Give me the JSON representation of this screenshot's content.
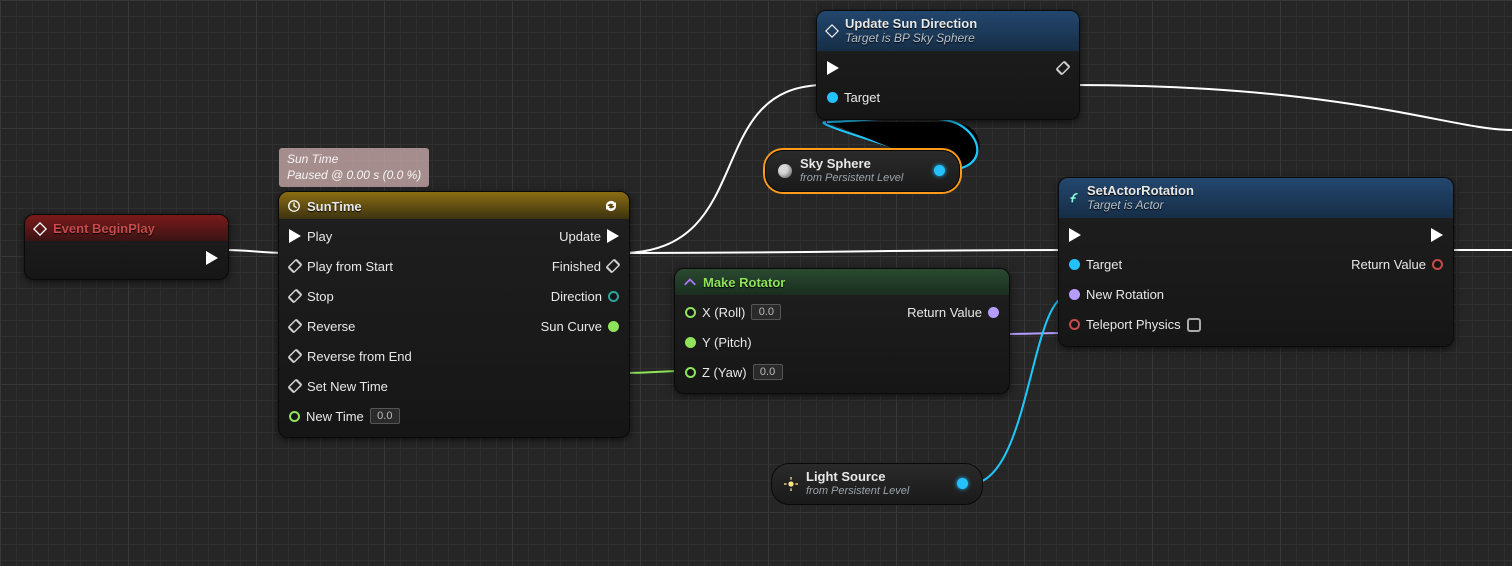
{
  "tooltip": {
    "title": "Sun Time",
    "status": "Paused @ 0.00 s (0.0 %)"
  },
  "eventBeginPlay": {
    "title": "Event BeginPlay"
  },
  "sunTime": {
    "title": "SunTime",
    "inputs": {
      "play": "Play",
      "playFromStart": "Play from Start",
      "stop": "Stop",
      "reverse": "Reverse",
      "reverseFromEnd": "Reverse from End",
      "setNewTime": "Set New Time",
      "newTime": "New Time",
      "newTimeVal": "0.0"
    },
    "outputs": {
      "update": "Update",
      "finished": "Finished",
      "direction": "Direction",
      "sunCurve": "Sun Curve"
    }
  },
  "skySphere": {
    "title": "Sky Sphere",
    "sub": "from Persistent Level"
  },
  "updateSun": {
    "title": "Update Sun Direction",
    "sub": "Target is BP Sky Sphere",
    "target": "Target"
  },
  "makeRotator": {
    "title": "Make Rotator",
    "x": "X (Roll)",
    "y": "Y (Pitch)",
    "z": "Z (Yaw)",
    "xv": "0.0",
    "zv": "0.0",
    "ret": "Return Value"
  },
  "lightSource": {
    "title": "Light Source",
    "sub": "from Persistent Level"
  },
  "setActorRot": {
    "title": "SetActorRotation",
    "sub": "Target is Actor",
    "target": "Target",
    "newRot": "New Rotation",
    "tele": "Teleport Physics",
    "ret": "Return Value"
  }
}
